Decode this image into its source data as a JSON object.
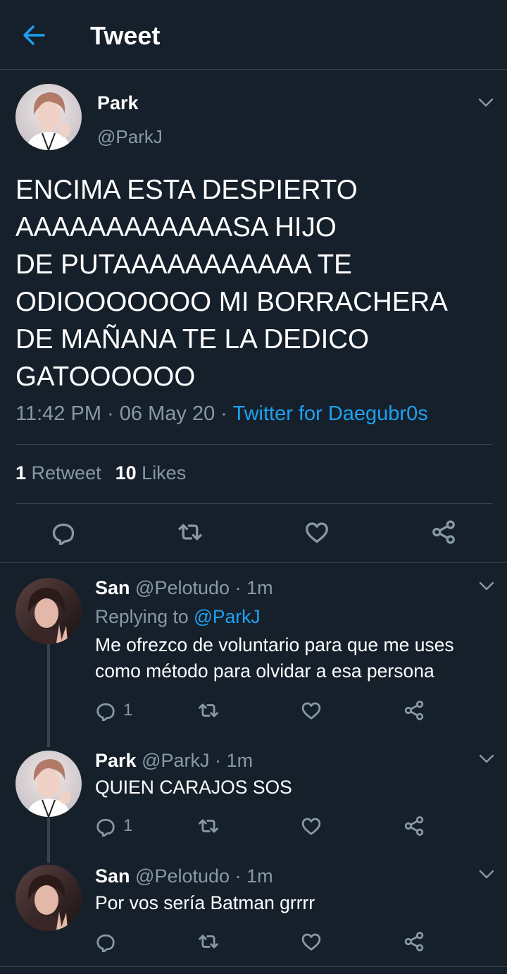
{
  "header": {
    "title": "Tweet"
  },
  "main_tweet": {
    "name": "Park",
    "handle": "@ParkJ",
    "text": "ENCIMA ESTA DESPIERTO\nAAAAAAAAAAAASA HIJO\nDE PUTAAAAAAAAAAA TE\nODIOOOOOOO MI BORRACHERA\nDE MAÑANA TE LA DEDICO\nGATOOOOOO",
    "time": "11:42 PM",
    "date": "06 May 20",
    "separator": "·",
    "source": "Twitter for Daegubr0s",
    "retweets_count": "1",
    "retweets_label": "Retweet",
    "likes_count": "10",
    "likes_label": "Likes"
  },
  "replies": [
    {
      "name": "San",
      "handle": "@Pelotudo",
      "separator": "·",
      "time": "1m",
      "replying_label": "Replying to",
      "replying_handle": "@ParkJ",
      "text": "Me ofrezco de voluntario para que me uses como método para olvidar a esa persona",
      "reply_count": "1"
    },
    {
      "name": "Park",
      "handle": "@ParkJ",
      "separator": "·",
      "time": "1m",
      "text": "QUIEN CARAJOS SOS",
      "reply_count": "1"
    },
    {
      "name": "San",
      "handle": "@Pelotudo",
      "separator": "·",
      "time": "1m",
      "text": "Por vos sería Batman grrrr",
      "reply_count": ""
    }
  ],
  "colors": {
    "background": "#15202b",
    "text_primary": "#ffffff",
    "text_secondary": "#8899a6",
    "accent": "#1da1f2",
    "divider": "#38444d"
  },
  "icons": [
    "back-arrow-icon",
    "chevron-down-icon",
    "reply-icon",
    "retweet-icon",
    "like-icon",
    "share-icon"
  ]
}
